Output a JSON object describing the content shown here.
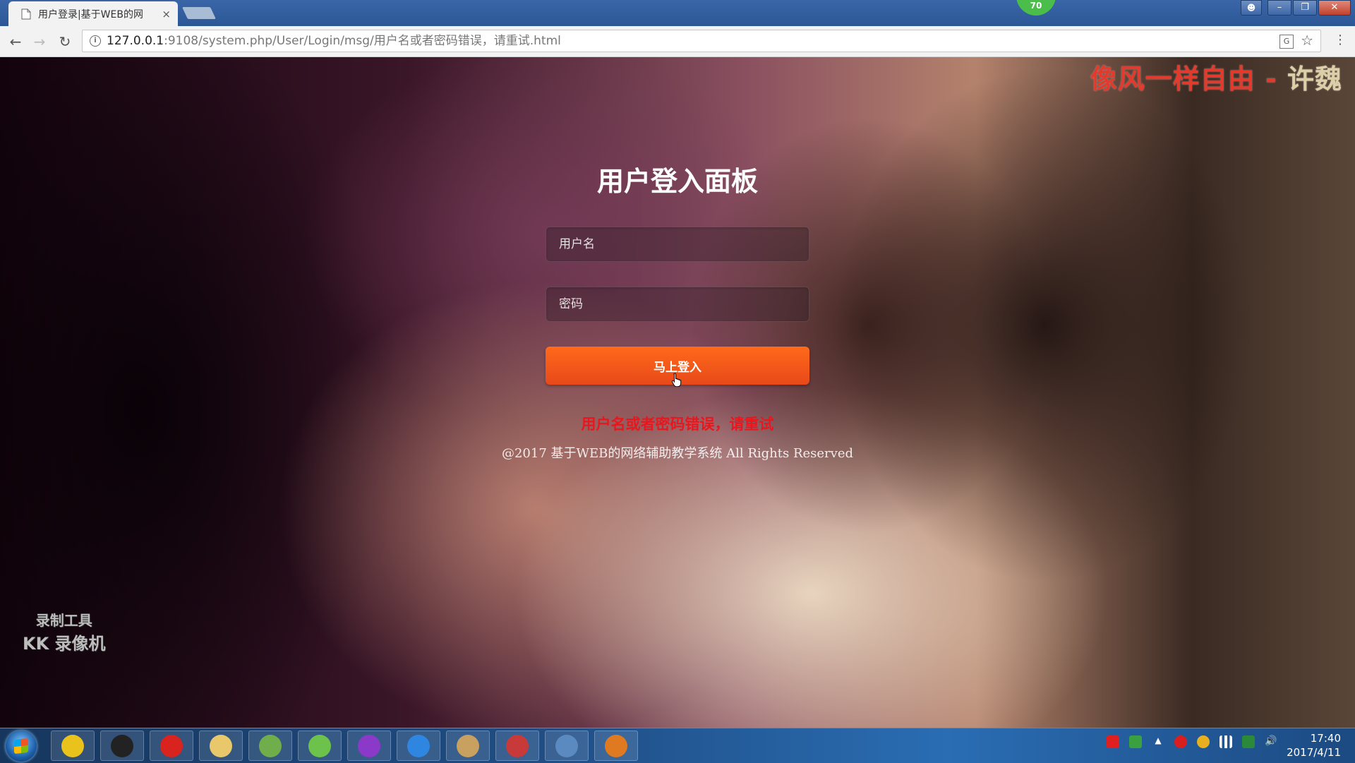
{
  "browser": {
    "tab_title": "用户登录|基于WEB的网",
    "tab_close": "×",
    "notification_count": "70",
    "url_host": "127.0.0.1",
    "url_path": ":9108/system.php/User/Login/msg/用户名或者密码错误，请重试.html"
  },
  "page": {
    "watermark_title": "像风一样自由 - ",
    "watermark_author": "许魏",
    "panel_title": "用户登入面板",
    "username_placeholder": "用户名",
    "password_placeholder": "密码",
    "login_button": "马上登入",
    "error_message": "用户名或者密码错误，请重试",
    "footer": "@2017 基于WEB的网络辅助教学系统 All Rights Reserved",
    "recorder_line1": "录制工具",
    "recorder_line2": "KK 录像机"
  },
  "taskbar": {
    "apps": [
      {
        "name": "chrome-icon",
        "color": "#e9c21b"
      },
      {
        "name": "qq-icon",
        "color": "#222222"
      },
      {
        "name": "netease-music-icon",
        "color": "#d9231f"
      },
      {
        "name": "file-explorer-icon",
        "color": "#e8c86a"
      },
      {
        "name": "editor-icon",
        "color": "#6fae4a"
      },
      {
        "name": "browser-360-icon",
        "color": "#6cc24a"
      },
      {
        "name": "phpstorm-icon",
        "color": "#8a39c8"
      },
      {
        "name": "wps-writer-icon",
        "color": "#2f86e0"
      },
      {
        "name": "tools-icon",
        "color": "#c8a060"
      },
      {
        "name": "toolbox-icon",
        "color": "#c83a3a"
      },
      {
        "name": "window-icon",
        "color": "#5a8ac0"
      },
      {
        "name": "recorder-icon",
        "color": "#e07a20"
      }
    ],
    "time": "17:40",
    "date": "2017/4/11"
  }
}
